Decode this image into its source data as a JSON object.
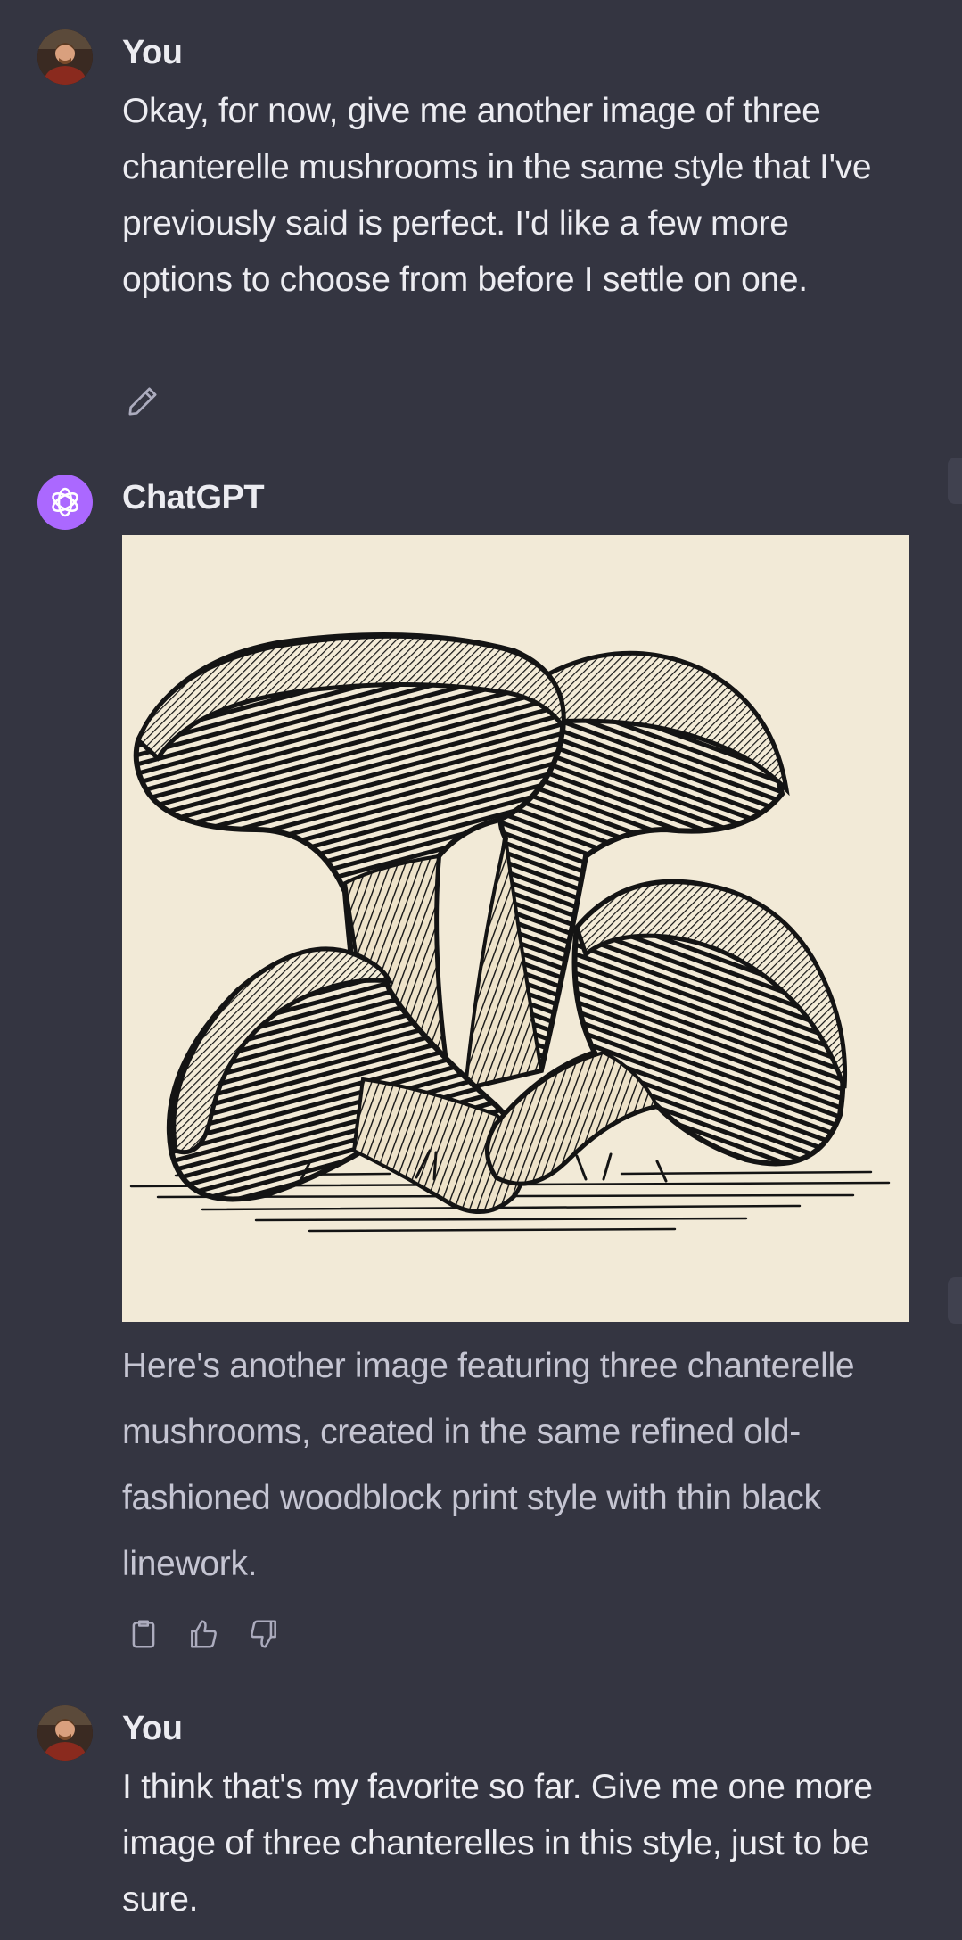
{
  "conversation": {
    "messages": [
      {
        "role": "user",
        "author": "You",
        "text": "Okay, for now, give me another image of three chanterelle mushrooms in the same style that I've previously said is perfect.  I'd like a few more options to choose from before I settle on one.",
        "actions": {
          "edit_icon": "pencil-icon"
        }
      },
      {
        "role": "assistant",
        "author": "ChatGPT",
        "image": {
          "subject": "three chanterelle mushrooms woodblock print"
        },
        "text": "Here's another image featuring three chanterelle mushrooms, created in the same refined old-fashioned woodblock print style with thin black linework.",
        "actions": {
          "copy_icon": "clipboard-icon",
          "like_icon": "thumbs-up-icon",
          "dislike_icon": "thumbs-down-icon"
        }
      },
      {
        "role": "user",
        "author": "You",
        "text": "I think that's my favorite so far.  Give me one more image of three chanterelles in this style, just to be sure."
      }
    ]
  },
  "colors": {
    "background": "#343541",
    "text": "#ececf1",
    "assistant_text": "#c5c5d2",
    "assistant_avatar": "#ab68ff",
    "icon": "#acacbe",
    "image_paper": "#f2ead7",
    "ink": "#141414"
  }
}
